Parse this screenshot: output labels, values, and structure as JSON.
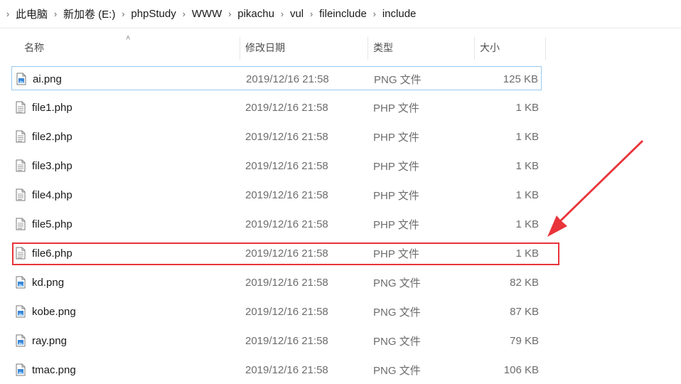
{
  "breadcrumb": {
    "items": [
      "此电脑",
      "新加卷 (E:)",
      "phpStudy",
      "WWW",
      "pikachu",
      "vul",
      "fileinclude",
      "include"
    ]
  },
  "columns": {
    "name": "名称",
    "date": "修改日期",
    "type": "类型",
    "size": "大小"
  },
  "files": [
    {
      "name": "ai.png",
      "date": "2019/12/16 21:58",
      "type": "PNG 文件",
      "size": "125 KB",
      "icon": "image-file-icon"
    },
    {
      "name": "file1.php",
      "date": "2019/12/16 21:58",
      "type": "PHP 文件",
      "size": "1 KB",
      "icon": "text-file-icon"
    },
    {
      "name": "file2.php",
      "date": "2019/12/16 21:58",
      "type": "PHP 文件",
      "size": "1 KB",
      "icon": "text-file-icon"
    },
    {
      "name": "file3.php",
      "date": "2019/12/16 21:58",
      "type": "PHP 文件",
      "size": "1 KB",
      "icon": "text-file-icon"
    },
    {
      "name": "file4.php",
      "date": "2019/12/16 21:58",
      "type": "PHP 文件",
      "size": "1 KB",
      "icon": "text-file-icon"
    },
    {
      "name": "file5.php",
      "date": "2019/12/16 21:58",
      "type": "PHP 文件",
      "size": "1 KB",
      "icon": "text-file-icon"
    },
    {
      "name": "file6.php",
      "date": "2019/12/16 21:58",
      "type": "PHP 文件",
      "size": "1 KB",
      "icon": "text-file-icon"
    },
    {
      "name": "kd.png",
      "date": "2019/12/16 21:58",
      "type": "PNG 文件",
      "size": "82 KB",
      "icon": "image-file-icon"
    },
    {
      "name": "kobe.png",
      "date": "2019/12/16 21:58",
      "type": "PNG 文件",
      "size": "87 KB",
      "icon": "image-file-icon"
    },
    {
      "name": "ray.png",
      "date": "2019/12/16 21:58",
      "type": "PNG 文件",
      "size": "79 KB",
      "icon": "image-file-icon"
    },
    {
      "name": "tmac.png",
      "date": "2019/12/16 21:58",
      "type": "PNG 文件",
      "size": "106 KB",
      "icon": "image-file-icon"
    }
  ],
  "colors": {
    "annotation": "#e8343a",
    "focus_border": "#99c9ef"
  }
}
